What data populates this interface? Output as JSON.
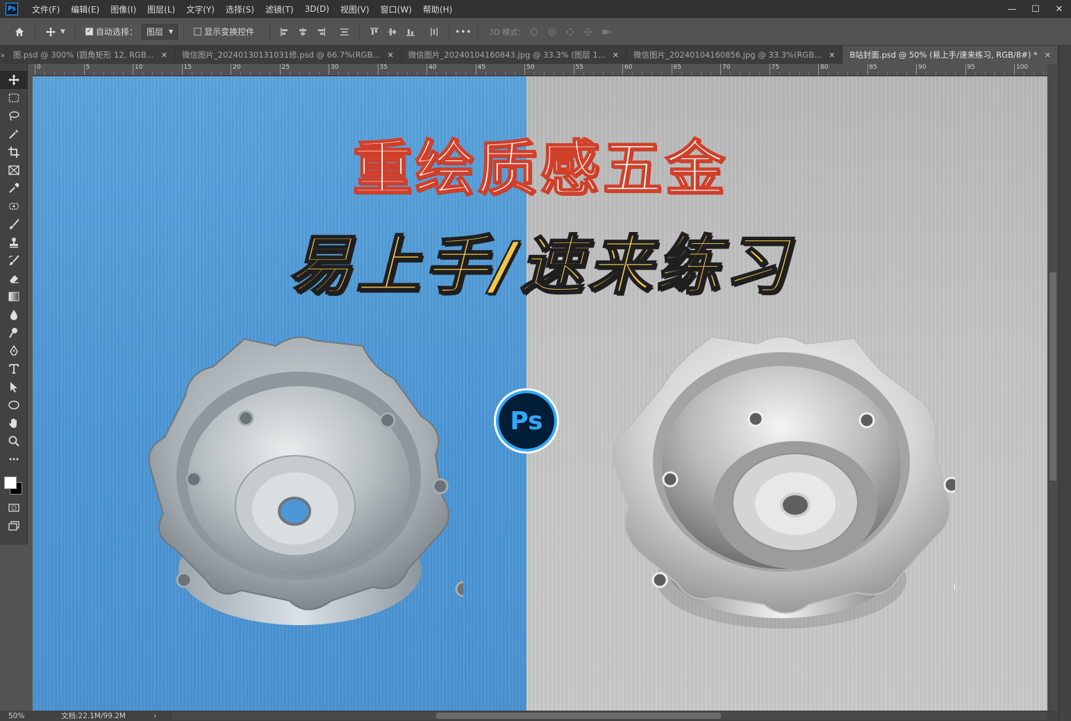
{
  "app": {
    "logo_text": "Ps"
  },
  "menu": [
    "文件(F)",
    "编辑(E)",
    "图像(I)",
    "图层(L)",
    "文字(Y)",
    "选择(S)",
    "滤镜(T)",
    "3D(D)",
    "视图(V)",
    "窗口(W)",
    "帮助(H)"
  ],
  "window_controls": {
    "minimize": "—",
    "maximize": "☐",
    "close": "✕"
  },
  "options_bar": {
    "auto_select_label": "自动选择：",
    "auto_select_checked": true,
    "auto_select_target": "图层",
    "show_transform_label": "显示变换控件",
    "show_transform_checked": false,
    "more_label": "•••",
    "mode_3d_label": "3D 模式："
  },
  "tabs": [
    {
      "label": "图.psd @ 300% (圆角矩形 12, RGB...",
      "active": false
    },
    {
      "label": "微信图片_20240130131031修.psd @ 66.7%(RGB...",
      "active": false
    },
    {
      "label": "微信图片_20240104160843.jpg @ 33.3% (图层 1...",
      "active": false
    },
    {
      "label": "微信图片_20240104160856.jpg @ 33.3%(RGB...",
      "active": false
    },
    {
      "label": "B站封面.psd @ 50% (易上手/速来练习, RGB/8#) *",
      "active": true
    }
  ],
  "tab_close_glyph": "✕",
  "tools": [
    {
      "name": "move-tool-icon",
      "active": true
    },
    {
      "name": "marquee-tool-icon"
    },
    {
      "name": "lasso-tool-icon"
    },
    {
      "name": "magic-wand-tool-icon"
    },
    {
      "name": "crop-tool-icon"
    },
    {
      "name": "frame-tool-icon"
    },
    {
      "name": "eyedropper-tool-icon"
    },
    {
      "name": "healing-brush-tool-icon"
    },
    {
      "name": "brush-tool-icon"
    },
    {
      "name": "clone-stamp-tool-icon"
    },
    {
      "name": "history-brush-tool-icon"
    },
    {
      "name": "eraser-tool-icon"
    },
    {
      "name": "gradient-tool-icon"
    },
    {
      "name": "blur-tool-icon"
    },
    {
      "name": "dodge-tool-icon"
    },
    {
      "name": "pen-tool-icon"
    },
    {
      "name": "type-tool-icon"
    },
    {
      "name": "path-selection-tool-icon"
    },
    {
      "name": "ellipse-tool-icon"
    },
    {
      "name": "hand-tool-icon"
    },
    {
      "name": "zoom-tool-icon"
    },
    {
      "name": "more-tools-icon"
    }
  ],
  "colors": {
    "foreground": "#ffffff",
    "background": "#000000",
    "accent": "#31a8ff"
  },
  "ruler_labels": [
    "0",
    "5",
    "10",
    "15",
    "20",
    "25",
    "30",
    "35",
    "40",
    "45",
    "50",
    "55",
    "60",
    "65",
    "70",
    "75",
    "80",
    "85",
    "90",
    "95",
    "100"
  ],
  "canvas": {
    "headline_1": "重绘质感五金",
    "headline_2": "易上手/速来练习",
    "badge_text": "Ps"
  },
  "status": {
    "zoom": "50%",
    "doc_info": "文档:22.1M/99.2M",
    "arrow": "›"
  }
}
